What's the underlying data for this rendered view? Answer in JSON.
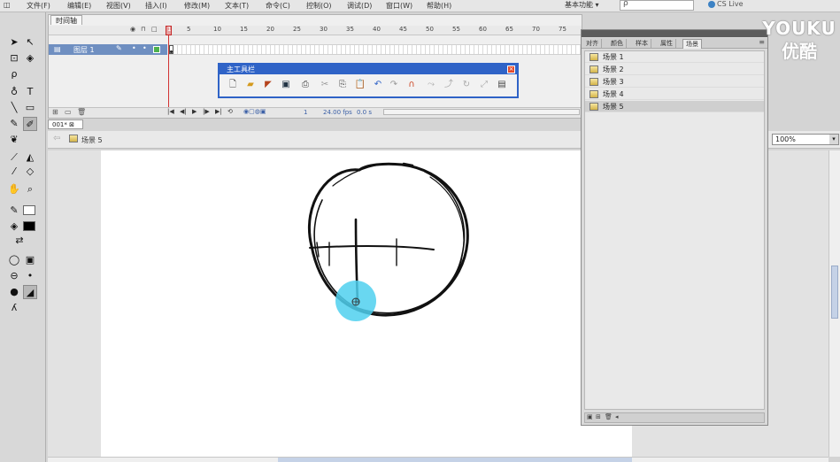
{
  "menubar": {
    "items": [
      "文件(F)",
      "编辑(E)",
      "视图(V)",
      "插入(I)",
      "修改(M)",
      "文本(T)",
      "命令(C)",
      "控制(O)",
      "调试(D)",
      "窗口(W)",
      "帮助(H)"
    ],
    "workspace": "基本功能 ▾",
    "search_placeholder": "ρ",
    "cs_live": "CS Live"
  },
  "watermark": {
    "line1": "YOUKU",
    "line2": "优酷"
  },
  "timeline": {
    "tab": "时间轴",
    "frame_numbers": [
      "1",
      "5",
      "10",
      "15",
      "20",
      "25",
      "30",
      "35",
      "40",
      "45",
      "50",
      "55",
      "60",
      "65",
      "70",
      "75"
    ],
    "layer_name": "图层 1",
    "current_frame": "1",
    "fps": "24.00 fps",
    "time": "0.0 s"
  },
  "main_toolbar": {
    "title": "主工具栏",
    "close": "×",
    "icons": [
      "new-icon",
      "open-icon",
      "bridge-icon",
      "save-icon",
      "print-icon",
      "cut-icon",
      "copy-icon",
      "paste-icon",
      "undo-icon",
      "redo-icon",
      "snap-icon",
      "smooth-icon",
      "straighten-icon",
      "rotate-icon",
      "scale-icon",
      "align-icon"
    ]
  },
  "document": {
    "tab": "001* ⊠",
    "scene": "场景 5",
    "zoom": "100%"
  },
  "scene_panel": {
    "tabs": [
      "对齐",
      "颜色",
      "样本",
      "属性",
      "场景"
    ],
    "active_tab": "场景",
    "scenes": [
      "场景 1",
      "场景 2",
      "场景 3",
      "场景 4",
      "场景 5"
    ],
    "selected_scene": "场景 5"
  },
  "colors": {
    "accent": "#2f63c7",
    "layer_highlight": "#6f8fc1",
    "playhead": "#d23232",
    "brush_cursor": "#4fd0ef"
  }
}
